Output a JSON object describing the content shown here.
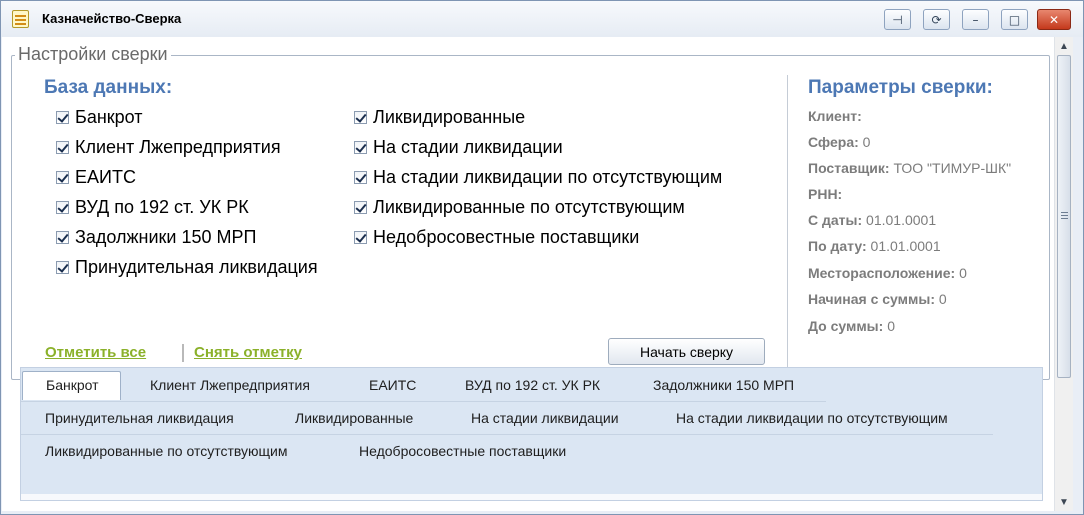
{
  "window": {
    "title": "Казначейство-Сверка",
    "buttons": {
      "pin": "⊣",
      "refresh": "⟳",
      "minimize": "–",
      "maximize": "□",
      "close": "✕"
    }
  },
  "settings": {
    "legend": "Настройки сверки",
    "db_heading": "База данных:",
    "left_checks": [
      "Банкрот",
      "Клиент Лжепредприятия",
      "ЕАИТС",
      "ВУД по 192 ст. УК РК",
      "Задолжники 150 МРП",
      "Принудительная ликвидация"
    ],
    "right_checks": [
      "Ликвидированные",
      "На стадии ликвидации",
      "На стадии ликвидации по отсутствующим",
      "Ликвидированные по отсутствующим",
      "Недобросовестные поставщики"
    ],
    "check_all": "Отметить все",
    "uncheck_all": "Снять отметку",
    "start_button": "Начать сверку"
  },
  "params": {
    "heading": "Параметры сверки:",
    "items": [
      {
        "label": "Клиент:",
        "value": ""
      },
      {
        "label": "Сфера:",
        "value": "0"
      },
      {
        "label": "Поставщик:",
        "value": "ТОО \"ТИМУР-ШК\""
      },
      {
        "label": "РНН:",
        "value": ""
      },
      {
        "label": "С даты:",
        "value": "01.01.0001"
      },
      {
        "label": "По дату:",
        "value": "01.01.0001"
      },
      {
        "label": "Месторасположение:",
        "value": "0"
      },
      {
        "label": "Начиная с суммы:",
        "value": "0"
      },
      {
        "label": "До суммы:",
        "value": "0"
      }
    ]
  },
  "tabs": {
    "row1": [
      "Банкрот",
      "Клиент Лжепредприятия",
      "ЕАИТС",
      "ВУД по 192 ст. УК РК",
      "Задолжники 150 МРП"
    ],
    "row2": [
      "Принудительная ликвидация",
      "Ликвидированные",
      "На стадии ликвидации",
      "На стадии ликвидации по отсутствующим"
    ],
    "row3": [
      "Ликвидированные по отсутствующим",
      "Недобросовестные поставщики"
    ]
  },
  "scrollbar": {
    "up": "▲",
    "down": "▼"
  },
  "colors": {
    "heading_blue": "#4d78b4",
    "link_green": "#8bb12a",
    "close_red": "#c4391c"
  }
}
